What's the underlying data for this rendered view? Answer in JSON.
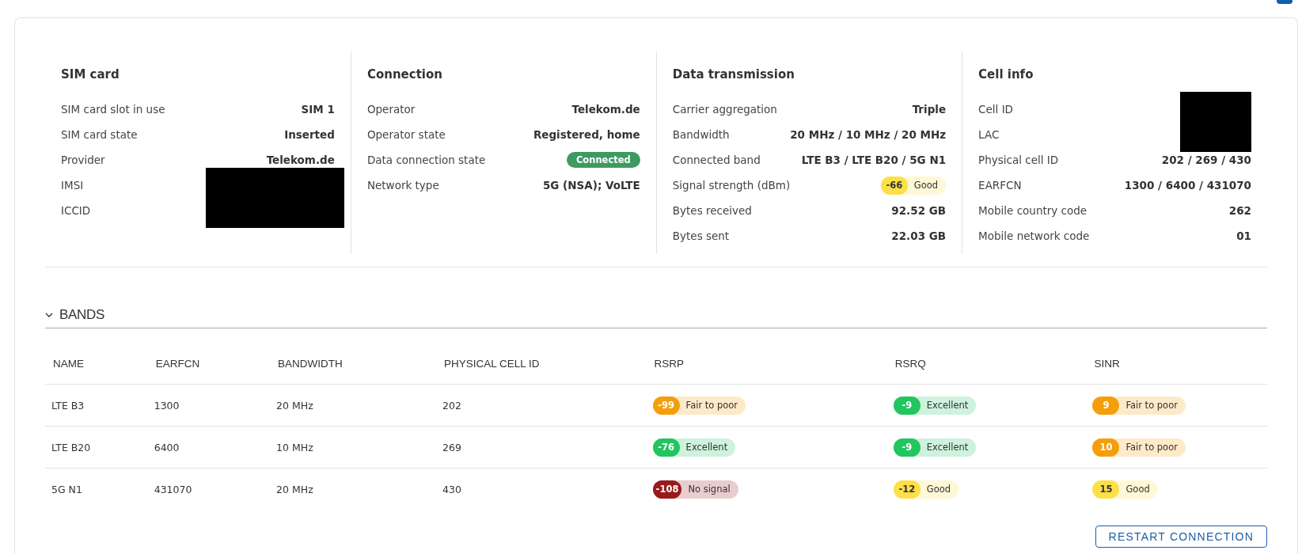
{
  "sections": [
    {
      "title": "SIM card",
      "rows": [
        {
          "label": "SIM card slot in use",
          "kind": "text",
          "value": "SIM 1"
        },
        {
          "label": "SIM card state",
          "kind": "text",
          "value": "Inserted"
        },
        {
          "label": "Provider",
          "kind": "text",
          "value": "Telekom.de"
        },
        {
          "label": "IMSI",
          "kind": "redacted"
        },
        {
          "label": "ICCID",
          "kind": "redacted"
        }
      ]
    },
    {
      "title": "Connection",
      "rows": [
        {
          "label": "Operator",
          "kind": "text",
          "value": "Telekom.de"
        },
        {
          "label": "Operator state",
          "kind": "text",
          "value": "Registered, home"
        },
        {
          "label": "Data connection state",
          "kind": "status",
          "value": "Connected"
        },
        {
          "label": "Network type",
          "kind": "text",
          "value": "5G (NSA); VoLTE"
        }
      ]
    },
    {
      "title": "Data transmission",
      "rows": [
        {
          "label": "Carrier aggregation",
          "kind": "text",
          "value": "Triple"
        },
        {
          "label": "Bandwidth",
          "kind": "text",
          "value": "20 MHz / 10 MHz / 20 MHz"
        },
        {
          "label": "Connected band",
          "kind": "text",
          "value": "LTE B3 / LTE B20 / 5G N1"
        },
        {
          "label": "Signal strength (dBm)",
          "kind": "signal",
          "signal": {
            "value": "-66",
            "text": "Good",
            "color": "#fde047"
          }
        },
        {
          "label": "Bytes received",
          "kind": "text",
          "value": "92.52 GB"
        },
        {
          "label": "Bytes sent",
          "kind": "text",
          "value": "22.03 GB"
        }
      ]
    },
    {
      "title": "Cell info",
      "rows": [
        {
          "label": "Cell ID",
          "kind": "redacted"
        },
        {
          "label": "LAC",
          "kind": "redacted"
        },
        {
          "label": "Physical cell ID",
          "kind": "text",
          "value": "202 / 269 / 430"
        },
        {
          "label": "EARFCN",
          "kind": "text",
          "value": "1300 / 6400 / 431070"
        },
        {
          "label": "Mobile country code",
          "kind": "text",
          "value": "262"
        },
        {
          "label": "Mobile network code",
          "kind": "text",
          "value": "01"
        }
      ]
    }
  ],
  "bands": {
    "title": "BANDS",
    "expanded": true,
    "columns": [
      "NAME",
      "EARFCN",
      "BANDWIDTH",
      "PHYSICAL CELL ID",
      "RSRP",
      "RSRQ",
      "SINR"
    ],
    "rows": [
      {
        "name": "LTE B3",
        "earfcn": "1300",
        "bandwidth": "20 MHz",
        "physical_cell_id": "202",
        "rsrp": {
          "value": "-99",
          "text": "Fair to poor",
          "color": "#f59e0b"
        },
        "rsrq": {
          "value": "-9",
          "text": "Excellent",
          "color": "#22c55e"
        },
        "sinr": {
          "value": "9",
          "text": "Fair to poor",
          "color": "#f59e0b"
        }
      },
      {
        "name": "LTE B20",
        "earfcn": "6400",
        "bandwidth": "10 MHz",
        "physical_cell_id": "269",
        "rsrp": {
          "value": "-76",
          "text": "Excellent",
          "color": "#22c55e"
        },
        "rsrq": {
          "value": "-9",
          "text": "Excellent",
          "color": "#22c55e"
        },
        "sinr": {
          "value": "10",
          "text": "Fair to poor",
          "color": "#f59e0b"
        }
      },
      {
        "name": "5G N1",
        "earfcn": "431070",
        "bandwidth": "20 MHz",
        "physical_cell_id": "430",
        "rsrp": {
          "value": "-108",
          "text": "No signal",
          "color": "#991b1b"
        },
        "rsrq": {
          "value": "-12",
          "text": "Good",
          "color": "#fde047"
        },
        "sinr": {
          "value": "15",
          "text": "Good",
          "color": "#fde047"
        }
      }
    ]
  },
  "restart_button": "RESTART CONNECTION"
}
